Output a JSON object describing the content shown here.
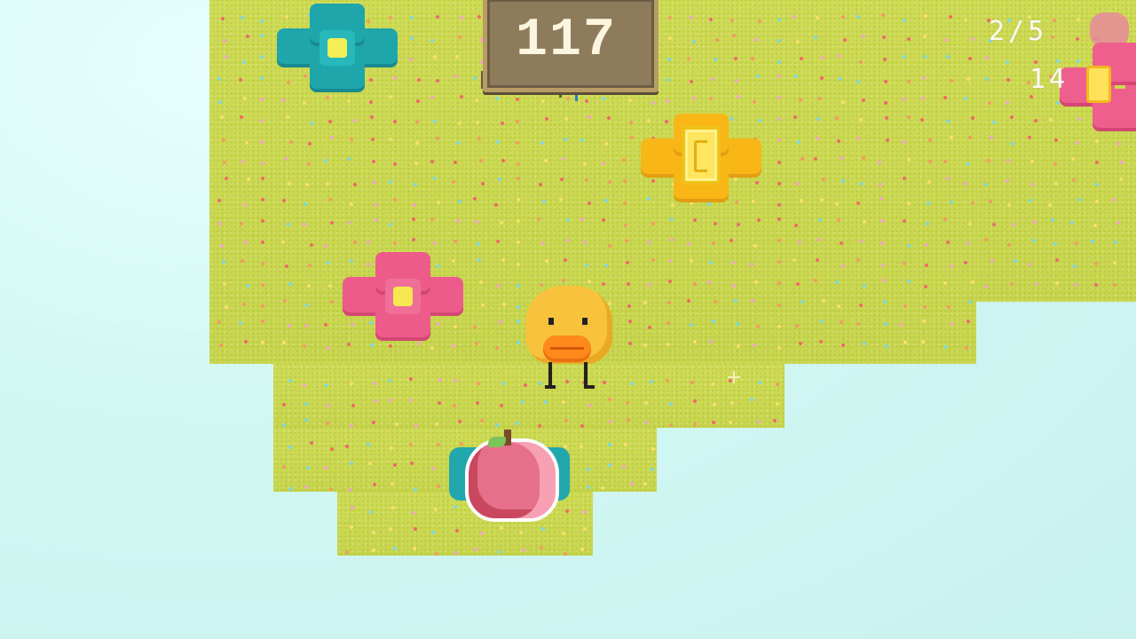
{
  "hud": {
    "timer": "117",
    "fruit_counter": "2/5",
    "coin_counter": "14"
  },
  "colors": {
    "sky": "#d2f7f3",
    "grass": "#c8d64e",
    "duck": "#f8c23c",
    "beak": "#ff8a1c",
    "flower_teal": "#1fa6ab",
    "flower_pink": "#ec5b8a",
    "flower_gold": "#f8b617"
  },
  "icons": {
    "player": "duck-icon",
    "collectible_fruit": "apple-icon",
    "collectible_coin": "coin-icon",
    "timer_sign": "wooden-sign-icon"
  }
}
